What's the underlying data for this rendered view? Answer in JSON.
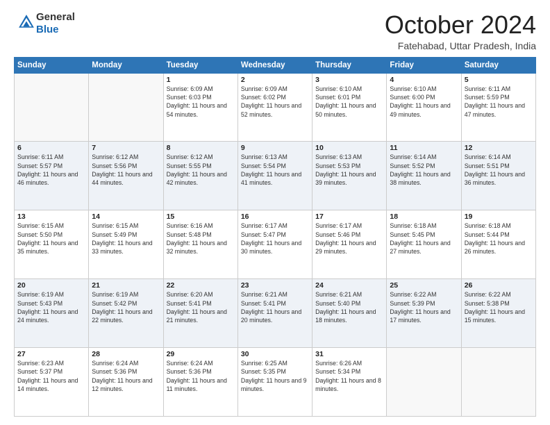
{
  "logo": {
    "general": "General",
    "blue": "Blue"
  },
  "title": "October 2024",
  "location": "Fatehabad, Uttar Pradesh, India",
  "days_of_week": [
    "Sunday",
    "Monday",
    "Tuesday",
    "Wednesday",
    "Thursday",
    "Friday",
    "Saturday"
  ],
  "weeks": [
    [
      {
        "day": "",
        "sunrise": "",
        "sunset": "",
        "daylight": ""
      },
      {
        "day": "",
        "sunrise": "",
        "sunset": "",
        "daylight": ""
      },
      {
        "day": "1",
        "sunrise": "Sunrise: 6:09 AM",
        "sunset": "Sunset: 6:03 PM",
        "daylight": "Daylight: 11 hours and 54 minutes."
      },
      {
        "day": "2",
        "sunrise": "Sunrise: 6:09 AM",
        "sunset": "Sunset: 6:02 PM",
        "daylight": "Daylight: 11 hours and 52 minutes."
      },
      {
        "day": "3",
        "sunrise": "Sunrise: 6:10 AM",
        "sunset": "Sunset: 6:01 PM",
        "daylight": "Daylight: 11 hours and 50 minutes."
      },
      {
        "day": "4",
        "sunrise": "Sunrise: 6:10 AM",
        "sunset": "Sunset: 6:00 PM",
        "daylight": "Daylight: 11 hours and 49 minutes."
      },
      {
        "day": "5",
        "sunrise": "Sunrise: 6:11 AM",
        "sunset": "Sunset: 5:59 PM",
        "daylight": "Daylight: 11 hours and 47 minutes."
      }
    ],
    [
      {
        "day": "6",
        "sunrise": "Sunrise: 6:11 AM",
        "sunset": "Sunset: 5:57 PM",
        "daylight": "Daylight: 11 hours and 46 minutes."
      },
      {
        "day": "7",
        "sunrise": "Sunrise: 6:12 AM",
        "sunset": "Sunset: 5:56 PM",
        "daylight": "Daylight: 11 hours and 44 minutes."
      },
      {
        "day": "8",
        "sunrise": "Sunrise: 6:12 AM",
        "sunset": "Sunset: 5:55 PM",
        "daylight": "Daylight: 11 hours and 42 minutes."
      },
      {
        "day": "9",
        "sunrise": "Sunrise: 6:13 AM",
        "sunset": "Sunset: 5:54 PM",
        "daylight": "Daylight: 11 hours and 41 minutes."
      },
      {
        "day": "10",
        "sunrise": "Sunrise: 6:13 AM",
        "sunset": "Sunset: 5:53 PM",
        "daylight": "Daylight: 11 hours and 39 minutes."
      },
      {
        "day": "11",
        "sunrise": "Sunrise: 6:14 AM",
        "sunset": "Sunset: 5:52 PM",
        "daylight": "Daylight: 11 hours and 38 minutes."
      },
      {
        "day": "12",
        "sunrise": "Sunrise: 6:14 AM",
        "sunset": "Sunset: 5:51 PM",
        "daylight": "Daylight: 11 hours and 36 minutes."
      }
    ],
    [
      {
        "day": "13",
        "sunrise": "Sunrise: 6:15 AM",
        "sunset": "Sunset: 5:50 PM",
        "daylight": "Daylight: 11 hours and 35 minutes."
      },
      {
        "day": "14",
        "sunrise": "Sunrise: 6:15 AM",
        "sunset": "Sunset: 5:49 PM",
        "daylight": "Daylight: 11 hours and 33 minutes."
      },
      {
        "day": "15",
        "sunrise": "Sunrise: 6:16 AM",
        "sunset": "Sunset: 5:48 PM",
        "daylight": "Daylight: 11 hours and 32 minutes."
      },
      {
        "day": "16",
        "sunrise": "Sunrise: 6:17 AM",
        "sunset": "Sunset: 5:47 PM",
        "daylight": "Daylight: 11 hours and 30 minutes."
      },
      {
        "day": "17",
        "sunrise": "Sunrise: 6:17 AM",
        "sunset": "Sunset: 5:46 PM",
        "daylight": "Daylight: 11 hours and 29 minutes."
      },
      {
        "day": "18",
        "sunrise": "Sunrise: 6:18 AM",
        "sunset": "Sunset: 5:45 PM",
        "daylight": "Daylight: 11 hours and 27 minutes."
      },
      {
        "day": "19",
        "sunrise": "Sunrise: 6:18 AM",
        "sunset": "Sunset: 5:44 PM",
        "daylight": "Daylight: 11 hours and 26 minutes."
      }
    ],
    [
      {
        "day": "20",
        "sunrise": "Sunrise: 6:19 AM",
        "sunset": "Sunset: 5:43 PM",
        "daylight": "Daylight: 11 hours and 24 minutes."
      },
      {
        "day": "21",
        "sunrise": "Sunrise: 6:19 AM",
        "sunset": "Sunset: 5:42 PM",
        "daylight": "Daylight: 11 hours and 22 minutes."
      },
      {
        "day": "22",
        "sunrise": "Sunrise: 6:20 AM",
        "sunset": "Sunset: 5:41 PM",
        "daylight": "Daylight: 11 hours and 21 minutes."
      },
      {
        "day": "23",
        "sunrise": "Sunrise: 6:21 AM",
        "sunset": "Sunset: 5:41 PM",
        "daylight": "Daylight: 11 hours and 20 minutes."
      },
      {
        "day": "24",
        "sunrise": "Sunrise: 6:21 AM",
        "sunset": "Sunset: 5:40 PM",
        "daylight": "Daylight: 11 hours and 18 minutes."
      },
      {
        "day": "25",
        "sunrise": "Sunrise: 6:22 AM",
        "sunset": "Sunset: 5:39 PM",
        "daylight": "Daylight: 11 hours and 17 minutes."
      },
      {
        "day": "26",
        "sunrise": "Sunrise: 6:22 AM",
        "sunset": "Sunset: 5:38 PM",
        "daylight": "Daylight: 11 hours and 15 minutes."
      }
    ],
    [
      {
        "day": "27",
        "sunrise": "Sunrise: 6:23 AM",
        "sunset": "Sunset: 5:37 PM",
        "daylight": "Daylight: 11 hours and 14 minutes."
      },
      {
        "day": "28",
        "sunrise": "Sunrise: 6:24 AM",
        "sunset": "Sunset: 5:36 PM",
        "daylight": "Daylight: 11 hours and 12 minutes."
      },
      {
        "day": "29",
        "sunrise": "Sunrise: 6:24 AM",
        "sunset": "Sunset: 5:36 PM",
        "daylight": "Daylight: 11 hours and 11 minutes."
      },
      {
        "day": "30",
        "sunrise": "Sunrise: 6:25 AM",
        "sunset": "Sunset: 5:35 PM",
        "daylight": "Daylight: 11 hours and 9 minutes."
      },
      {
        "day": "31",
        "sunrise": "Sunrise: 6:26 AM",
        "sunset": "Sunset: 5:34 PM",
        "daylight": "Daylight: 11 hours and 8 minutes."
      },
      {
        "day": "",
        "sunrise": "",
        "sunset": "",
        "daylight": ""
      },
      {
        "day": "",
        "sunrise": "",
        "sunset": "",
        "daylight": ""
      }
    ]
  ]
}
